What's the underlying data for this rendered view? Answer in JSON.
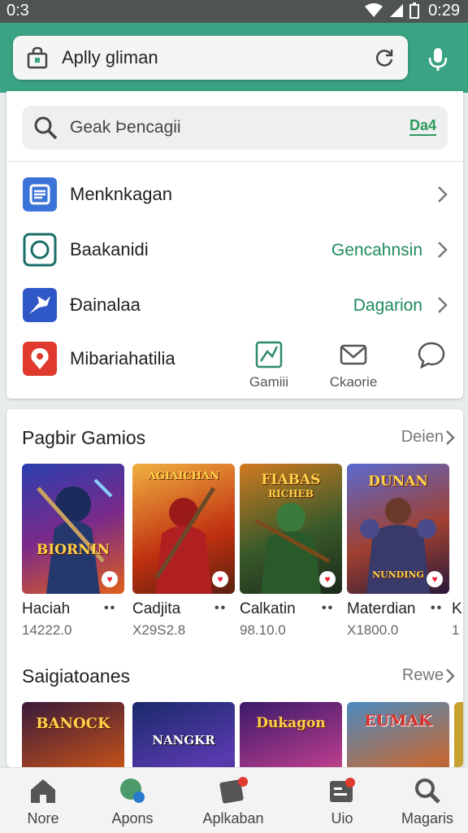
{
  "status_bar": {
    "time_left": "0:3",
    "time_right": "0:29"
  },
  "app_bar": {
    "title": "Aplly gliman",
    "store_icon": "store-icon",
    "refresh_icon": "refresh-icon",
    "mic_icon": "mic-icon"
  },
  "inner_search": {
    "placeholder": "Geak Þencagii",
    "badge": "Da4"
  },
  "rows": [
    {
      "label": "Menknkagan",
      "action": "",
      "icon": "document-icon",
      "color": "#3b73d9"
    },
    {
      "label": "Baakanidi",
      "action": "Gencahnsin",
      "icon": "circle-icon",
      "color": "#1a6e6a"
    },
    {
      "label": "Ðainalaa",
      "action": "Dagarion",
      "icon": "bird-icon",
      "color": "#2f57c6"
    },
    {
      "label": "Mibariahatilia",
      "action": "",
      "icon": "map-icon",
      "color": "#e03a2e"
    }
  ],
  "mini_actions": [
    {
      "label": "Gamiii",
      "icon": "chart-icon"
    },
    {
      "label": "Ckaorie",
      "icon": "mail-icon"
    },
    {
      "label": "",
      "icon": "chat-icon"
    }
  ],
  "section1": {
    "title": "Pagbir Gamios",
    "more": "Deien",
    "games": [
      {
        "name": "Haciah",
        "meta": "14222.0",
        "art_title": "BIORNIN",
        "art_sub": ""
      },
      {
        "name": "Cadjita",
        "meta": "X29S2.8",
        "art_title": "AGIAICHAN",
        "art_sub": ""
      },
      {
        "name": "Calkatin",
        "meta": "98.10.0",
        "art_title": "FIABAS",
        "art_sub": "RICHEB"
      },
      {
        "name": "Materdian",
        "meta": "X1800.0",
        "art_title": "DUNAN",
        "art_sub": "NUNDING"
      }
    ],
    "partial_next": {
      "name": "K",
      "meta": "1"
    }
  },
  "section2": {
    "title": "Saigiatoanes",
    "more": "Rewe",
    "games": [
      {
        "art_title": "BANOCK"
      },
      {
        "art_title": "NANGKR"
      },
      {
        "art_title": "Dukagon"
      },
      {
        "art_title": "EUMAK"
      }
    ]
  },
  "bottom_nav": [
    {
      "label": "Nore",
      "icon": "home-icon"
    },
    {
      "label": "Apons",
      "icon": "apps-icon"
    },
    {
      "label": "Aplkaban",
      "icon": "app-badge-icon"
    },
    {
      "label": "Uio",
      "icon": "updates-icon"
    },
    {
      "label": "Magaris",
      "icon": "search-icon"
    }
  ],
  "colors": {
    "primary": "#3aa383",
    "action_text": "#1f8a5c",
    "status_bar": "#4f5452"
  }
}
